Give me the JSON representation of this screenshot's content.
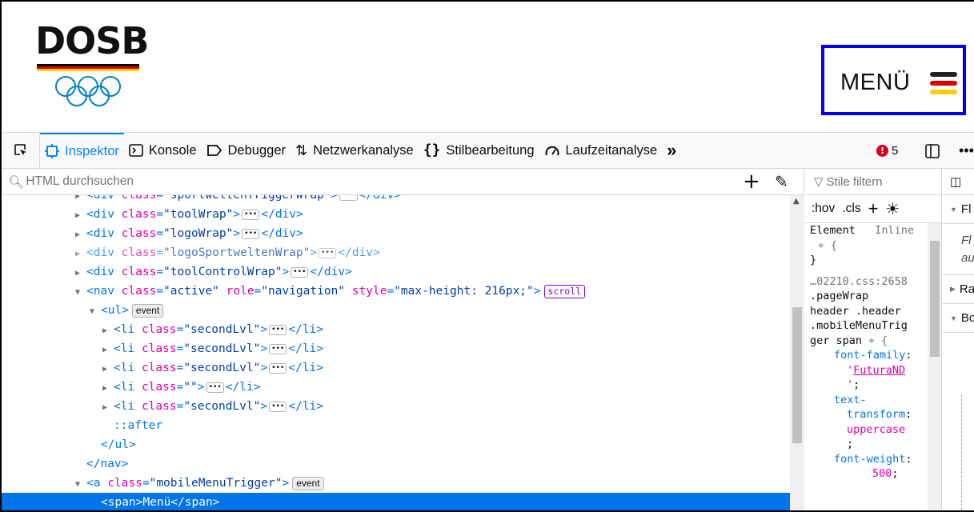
{
  "site": {
    "logo_text": "DOSB",
    "menu_label": "MENÜ",
    "colors": {
      "black": "#000000",
      "red": "#dd0000",
      "gold": "#ffcc00",
      "olympic_blue": "#0081c8",
      "highlight_border": "#0000ff"
    }
  },
  "toolbar": {
    "tabs": [
      {
        "label": "Inspektor",
        "icon": "inspector-icon"
      },
      {
        "label": "Konsole",
        "icon": "console-icon"
      },
      {
        "label": "Debugger",
        "icon": "debugger-icon"
      },
      {
        "label": "Netzwerkanalyse",
        "icon": "network-icon"
      },
      {
        "label": "Stilbearbeitung",
        "icon": "style-editor-icon"
      },
      {
        "label": "Laufzeitanalyse",
        "icon": "performance-icon"
      }
    ],
    "overflow": "»",
    "error_count": "5"
  },
  "markup": {
    "search_placeholder": "HTML durchsuchen",
    "rows": {
      "r0": {
        "tag_open": "<div",
        "attr_class": "class",
        "val": "\"sportweltenTriggerWrap\"",
        "close": "</div>"
      },
      "r1": {
        "tag_open": "<div",
        "attr_class": "class",
        "val": "\"toolWrap\"",
        "close": "</div>"
      },
      "r2": {
        "tag_open": "<div",
        "attr_class": "class",
        "val": "\"logoWrap\"",
        "close": "</div>"
      },
      "r3": {
        "tag_open": "<div",
        "attr_class": "class",
        "val": "\"logoSportweltenWrap\"",
        "close": "</div>"
      },
      "r4": {
        "tag_open": "<div",
        "attr_class": "class",
        "val": "\"toolControlWrap\"",
        "close": "</div>"
      },
      "r5": {
        "tag_open": "<nav",
        "attr_class": "class",
        "val": "\"active\"",
        "attr_role": "role",
        "val_role": "\"navigation\"",
        "attr_style": "style",
        "val_style": "\"max-height: 216px;\"",
        "badge": "scroll"
      },
      "r6": {
        "tag": "<ul>",
        "badge": "event"
      },
      "li": [
        {
          "tag_open": "<li",
          "attr_class": "class",
          "val": "\"secondLvl\"",
          "close": "</li>"
        },
        {
          "tag_open": "<li",
          "attr_class": "class",
          "val": "\"secondLvl\"",
          "close": "</li>"
        },
        {
          "tag_open": "<li",
          "attr_class": "class",
          "val": "\"secondLvl\"",
          "close": "</li>"
        },
        {
          "tag_open": "<li",
          "attr_class": "class",
          "val": "\"\"",
          "close": "</li>"
        },
        {
          "tag_open": "<li",
          "attr_class": "class",
          "val": "\"secondLvl\"",
          "close": "</li>"
        }
      ],
      "after": "::after",
      "ul_close": "</ul>",
      "nav_close": "</nav>",
      "a": {
        "tag_open": "<a",
        "attr_class": "class",
        "val": "\"mobileMenuTrigger\"",
        "badge": "event"
      },
      "span": {
        "text": "<span>Menü</span>"
      }
    }
  },
  "rules": {
    "filter_placeholder": "Stile filtern",
    "hov": ":hov",
    "cls": ".cls",
    "element": "Element",
    "inline": "Inline",
    "source": "…02210.css:2658",
    "selector_lines": [
      ".pageWrap",
      "header .header",
      ".mobileMenuTrig",
      "ger span"
    ],
    "p1": "font-family",
    "v1a": "'",
    "v1b": "FuturaND",
    "v1c": "'",
    "p2a": "text-",
    "p2b": "transform",
    "v2": "uppercase",
    "p3": "font-weight",
    "v3": "500"
  },
  "layout_panel": {
    "items": [
      {
        "label": "Fl",
        "expanded": true
      },
      {
        "label": "Ra",
        "expanded": false
      },
      {
        "label": "Bo",
        "expanded": true
      }
    ],
    "flex_note_1": "Fl",
    "flex_note_2": "au"
  }
}
